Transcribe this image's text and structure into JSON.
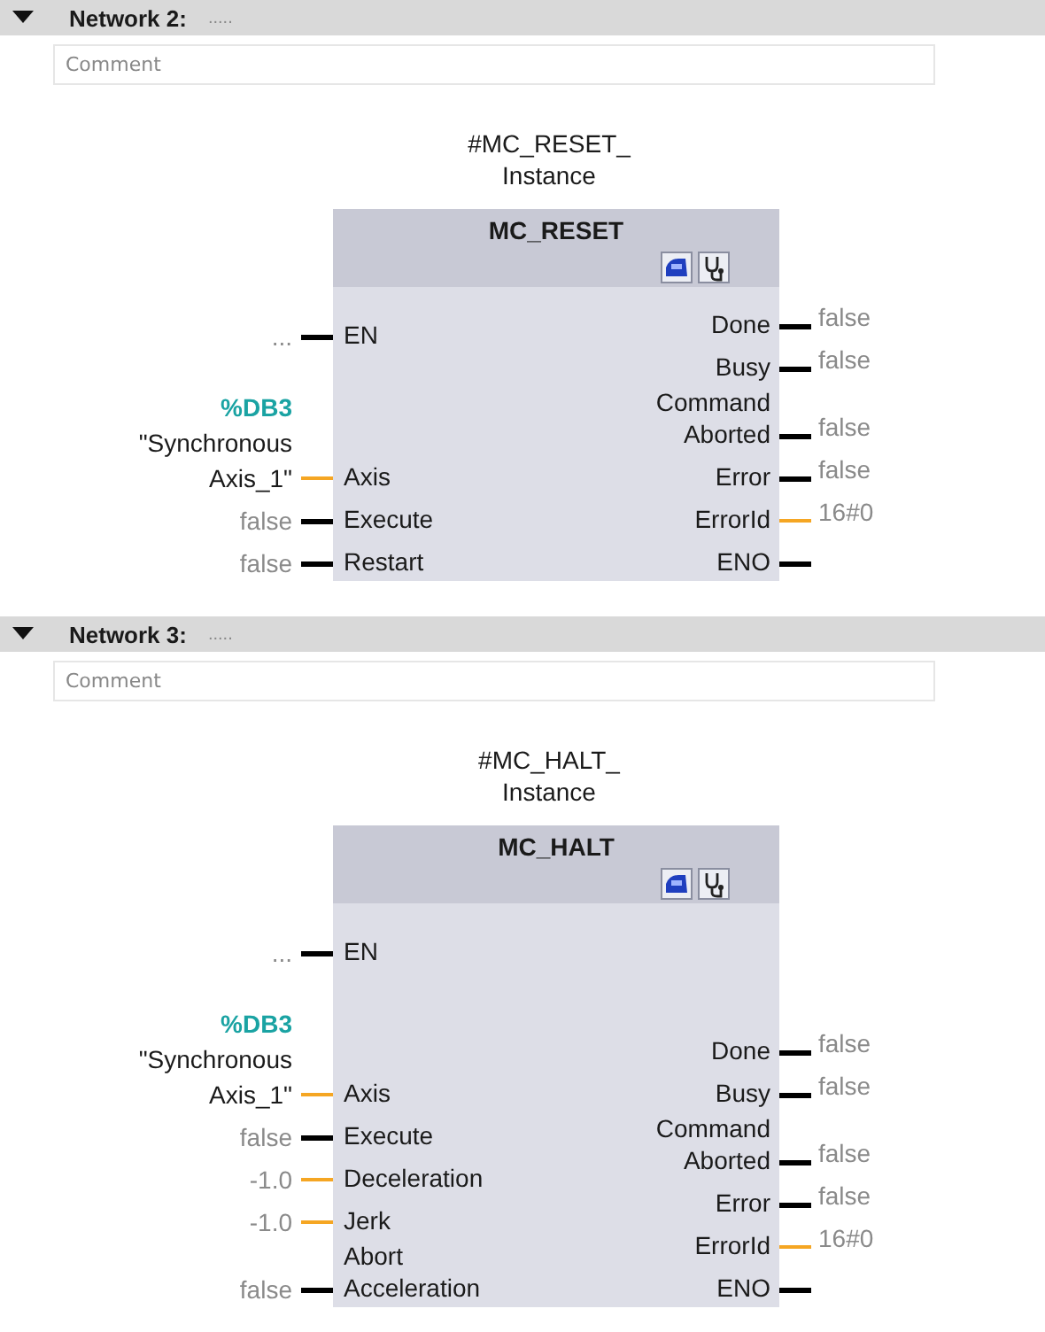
{
  "networks": [
    {
      "title": "Network 2:",
      "dots": ".....",
      "expanded": true,
      "comment_placeholder": "Comment",
      "instance": "#MC_RESET_\nInstance",
      "block": "MC_RESET",
      "inputs": [
        {
          "label": "EN",
          "value": "...",
          "kind": "bool"
        },
        {
          "label": "Axis",
          "address": "%DB3",
          "value": "\"Synchronous\nAxis_1\"",
          "kind": "data"
        },
        {
          "label": "Execute",
          "value": "false",
          "kind": "bool"
        },
        {
          "label": "Restart",
          "value": "false",
          "kind": "bool"
        }
      ],
      "outputs": [
        {
          "label": "Done",
          "value": "false",
          "kind": "bool"
        },
        {
          "label": "Busy",
          "value": "false",
          "kind": "bool"
        },
        {
          "label": "Command\nAborted",
          "value": "false",
          "kind": "bool"
        },
        {
          "label": "Error",
          "value": "false",
          "kind": "bool"
        },
        {
          "label": "ErrorId",
          "value": "16#0",
          "kind": "data"
        },
        {
          "label": "ENO",
          "kind": "bool"
        }
      ]
    },
    {
      "title": "Network 3:",
      "dots": ".....",
      "expanded": true,
      "comment_placeholder": "Comment",
      "instance": "#MC_HALT_\nInstance",
      "block": "MC_HALT",
      "inputs": [
        {
          "label": "EN",
          "value": "...",
          "kind": "bool"
        },
        {
          "label": "Axis",
          "address": "%DB3",
          "value": "\"Synchronous\nAxis_1\"",
          "kind": "data"
        },
        {
          "label": "Execute",
          "value": "false",
          "kind": "bool"
        },
        {
          "label": "Deceleration",
          "value": "-1.0",
          "kind": "data"
        },
        {
          "label": "Jerk",
          "value": "-1.0",
          "kind": "data"
        },
        {
          "label": "Abort\nAcceleration",
          "value": "false",
          "kind": "bool"
        }
      ],
      "outputs": [
        {
          "label": "Done",
          "value": "false",
          "kind": "bool"
        },
        {
          "label": "Busy",
          "value": "false",
          "kind": "bool"
        },
        {
          "label": "Command\nAborted",
          "value": "false",
          "kind": "bool"
        },
        {
          "label": "Error",
          "value": "false",
          "kind": "bool"
        },
        {
          "label": "ErrorId",
          "value": "16#0",
          "kind": "data"
        },
        {
          "label": "ENO",
          "kind": "bool"
        }
      ]
    }
  ]
}
